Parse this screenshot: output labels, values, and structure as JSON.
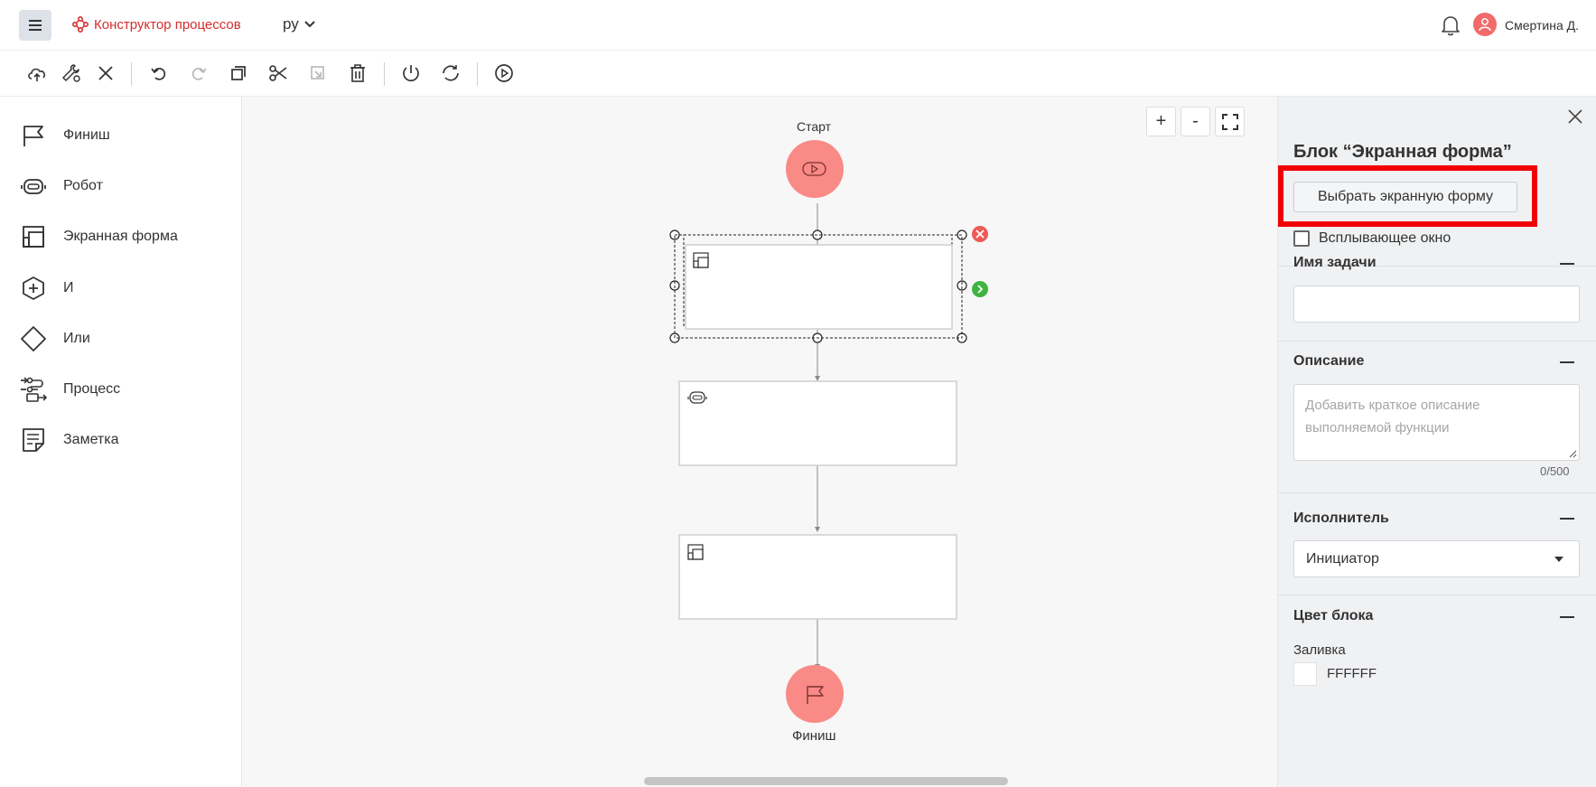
{
  "header": {
    "app_title": "Конструктор процессов",
    "lang": "ру",
    "user_name": "Смертина Д."
  },
  "toolbar": {
    "buttons": [
      "cloud-upload-icon",
      "settings-wrench-icon",
      "close-icon",
      "undo-icon",
      "redo-icon",
      "copy-icon",
      "cut-icon",
      "paste-icon",
      "delete-icon",
      "power-icon",
      "refresh-icon",
      "play-icon"
    ]
  },
  "palette": {
    "items": [
      {
        "label": "Финиш",
        "icon": "flag-icon"
      },
      {
        "label": "Робот",
        "icon": "robot-icon"
      },
      {
        "label": "Экранная форма",
        "icon": "screen-form-icon"
      },
      {
        "label": "И",
        "icon": "and-hexagon-icon"
      },
      {
        "label": "Или",
        "icon": "or-diamond-icon"
      },
      {
        "label": "Процесс",
        "icon": "process-icon"
      },
      {
        "label": "Заметка",
        "icon": "note-icon"
      }
    ]
  },
  "canvas": {
    "start_label": "Старт",
    "finish_label": "Финиш",
    "zoom_in": "+",
    "zoom_out": "-"
  },
  "props": {
    "title": "Блок “Экранная форма”",
    "select_form_button": "Выбрать экранную форму",
    "popup_label": "Всплывающее окно",
    "task_name_heading": "Имя задачи",
    "task_name_value": "",
    "description_heading": "Описание",
    "description_placeholder": "Добавить краткое описание выполняемой функции",
    "description_counter": "0/500",
    "executor_heading": "Исполнитель",
    "executor_value": "Инициатор",
    "color_heading": "Цвет блока",
    "fill_label": "Заливка",
    "fill_value": "FFFFFF"
  },
  "colors": {
    "accent": "#d62d2d",
    "node_fill": "#f98a85",
    "highlight": "#f00000",
    "success": "#3fb43f"
  }
}
